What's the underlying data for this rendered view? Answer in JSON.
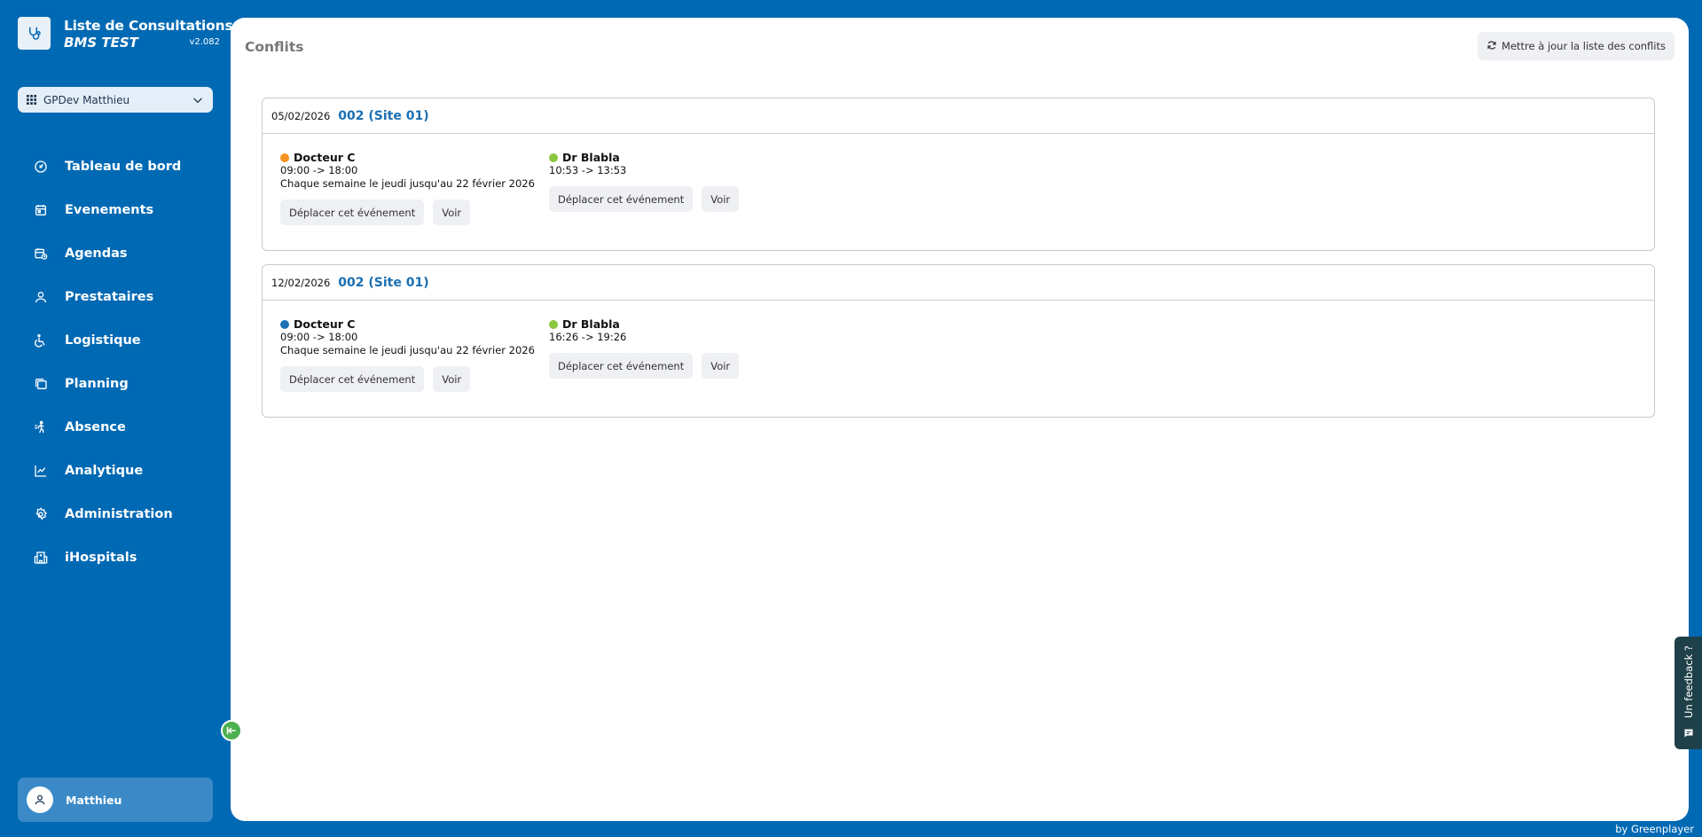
{
  "app": {
    "title": "Liste de Consultations",
    "subtitle": "BMS TEST",
    "version": "v2.082"
  },
  "site_selector": {
    "value": "GPDev Matthieu"
  },
  "nav": [
    {
      "label": "Tableau de bord",
      "icon": "dashboard-icon"
    },
    {
      "label": "Evenements",
      "icon": "calendar-icon"
    },
    {
      "label": "Agendas",
      "icon": "calendar-clock-icon"
    },
    {
      "label": "Prestataires",
      "icon": "user-icon"
    },
    {
      "label": "Logistique",
      "icon": "wheelchair-icon"
    },
    {
      "label": "Planning",
      "icon": "stack-icon"
    },
    {
      "label": "Absence",
      "icon": "walking-icon"
    },
    {
      "label": "Analytique",
      "icon": "chart-icon"
    },
    {
      "label": "Administration",
      "icon": "gear-icon"
    },
    {
      "label": "iHospitals",
      "icon": "hospital-icon"
    }
  ],
  "user": {
    "name": "Matthieu"
  },
  "page": {
    "title": "Conflits",
    "refresh_label": "Mettre à jour la liste des conflits"
  },
  "conflicts": [
    {
      "date": "05/02/2026",
      "site": "002 (Site 01)",
      "events": [
        {
          "name": "Docteur C",
          "color": "#f7931e",
          "time": "09:00 -> 18:00",
          "recurrence": "Chaque semaine le jeudi jusqu'au 22 février 2026",
          "move_label": "Déplacer cet événement",
          "view_label": "Voir"
        },
        {
          "name": "Dr Blabla",
          "color": "#8cc63f",
          "time": "10:53 -> 13:53",
          "recurrence": "",
          "move_label": "Déplacer cet événement",
          "view_label": "Voir"
        }
      ]
    },
    {
      "date": "12/02/2026",
      "site": "002 (Site 01)",
      "events": [
        {
          "name": "Docteur C",
          "color": "#1b6fb2",
          "time": "09:00 -> 18:00",
          "recurrence": "Chaque semaine le jeudi jusqu'au 22 février 2026",
          "move_label": "Déplacer cet événement",
          "view_label": "Voir"
        },
        {
          "name": "Dr Blabla",
          "color": "#8cc63f",
          "time": "16:26 -> 19:26",
          "recurrence": "",
          "move_label": "Déplacer cet événement",
          "view_label": "Voir"
        }
      ]
    }
  ],
  "feedback": {
    "label": "Un feedback ?"
  },
  "footer": {
    "text": "by Greenplayer"
  }
}
